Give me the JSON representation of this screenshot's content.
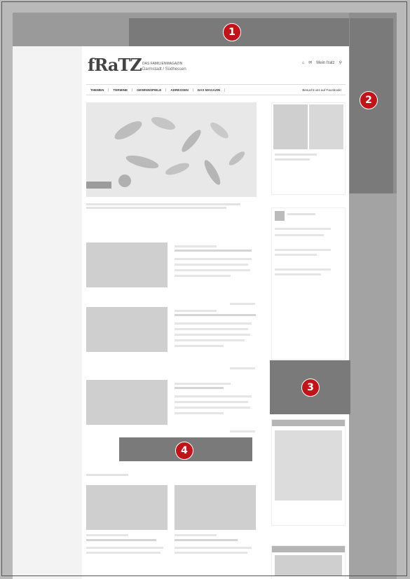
{
  "markers": [
    "1",
    "2",
    "3",
    "4"
  ],
  "header": {
    "logo": "fRaTZ",
    "tagline1": "DAS FAMILIENMAGAZIN",
    "tagline2": "Darmstadt / Südhessen",
    "mein_fratz": "Mein fratz"
  },
  "nav": {
    "items": [
      "THEMEN",
      "TERMINE",
      "GEWINNSPIELE",
      "ADRESSEN",
      "DAS MAGAZIN"
    ],
    "facebook": "Besucht uns auf Facebook!"
  }
}
